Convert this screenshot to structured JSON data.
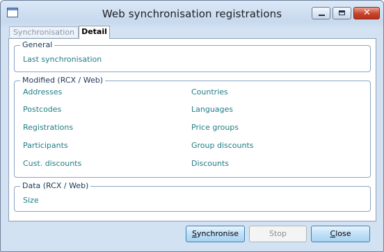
{
  "window": {
    "title": "Web synchronisation registrations"
  },
  "tabs": [
    {
      "label": "Synchronisation",
      "active": false
    },
    {
      "label": "Detail",
      "active": true
    }
  ],
  "groups": {
    "general": {
      "legend": "General",
      "fields": [
        "Last synchronisation"
      ]
    },
    "modified": {
      "legend": "Modified (RCX / Web)",
      "left": [
        "Addresses",
        "Postcodes",
        "Registrations",
        "Participants",
        "Cust. discounts"
      ],
      "right": [
        "Countries",
        "Languages",
        "Price groups",
        "Group discounts",
        "Discounts"
      ]
    },
    "data": {
      "legend": "Data (RCX / Web)",
      "fields": [
        "Size"
      ]
    }
  },
  "buttons": {
    "synchronise": {
      "label_underlined": "S",
      "label_rest": "ynchronise"
    },
    "stop": {
      "label": "Stop"
    },
    "close": {
      "label_underlined": "C",
      "label_rest": "lose"
    }
  },
  "colors": {
    "field_text": "#1f7c85",
    "legend_text": "#1c3556",
    "close_button": "#c9432b"
  }
}
